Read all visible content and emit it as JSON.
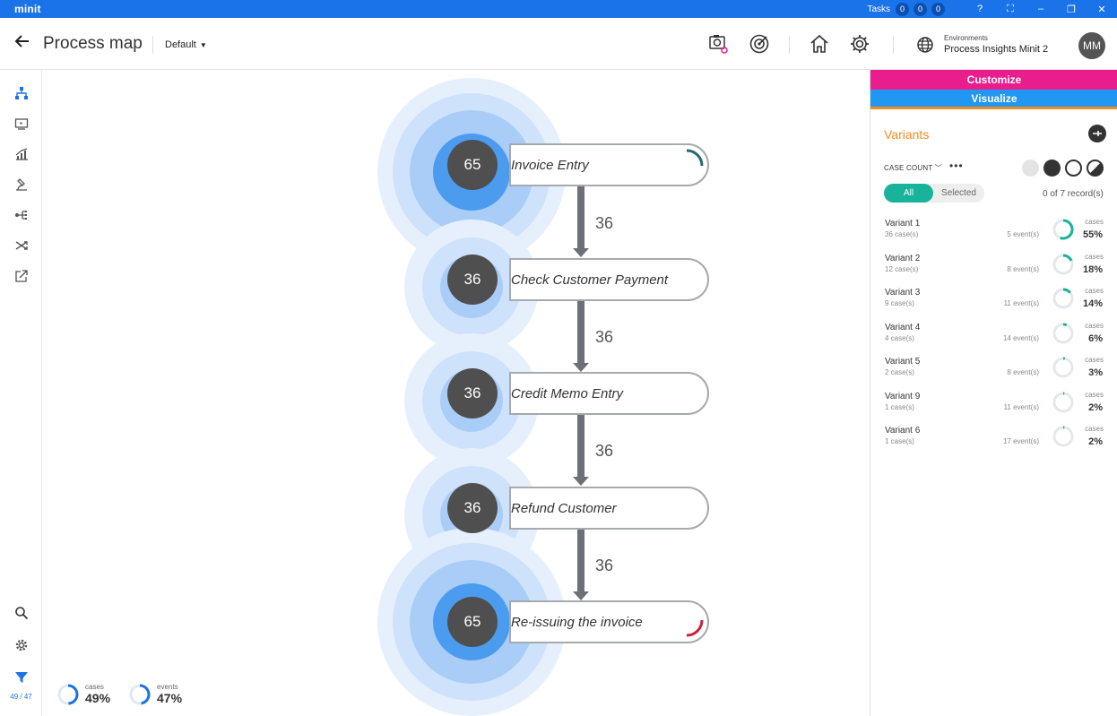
{
  "titlebar": {
    "brand": "minit",
    "tasks_label": "Tasks",
    "task_counts": [
      "0",
      "0",
      "0"
    ],
    "window_buttons": [
      "?",
      "⛶",
      "–",
      "❐",
      "✕"
    ],
    "color": "#1a73e8"
  },
  "header": {
    "title": "Process map",
    "view_select": "Default",
    "env_label": "Environments",
    "env_name": "Process Insights Minit 2",
    "avatar": "MM",
    "icons": [
      "screenshot-settings-icon",
      "target-icon",
      "home-icon",
      "gear-icon",
      "globe-icon"
    ]
  },
  "leftrail": {
    "icons": [
      "process-map-icon",
      "dashboard-icon",
      "chart-icon",
      "microscope-icon",
      "rules-icon",
      "shuffle-icon",
      "export-icon",
      "search-icon",
      "gear-icon",
      "filter-icon"
    ],
    "filter_count": "49 / 47",
    "active_color": "#1a73e8"
  },
  "process_map": {
    "nodes": [
      {
        "label": "Invoice Entry",
        "count": "65",
        "arc": "start"
      },
      {
        "label": "Check Customer Payment",
        "count": "36"
      },
      {
        "label": "Credit Memo Entry",
        "count": "36"
      },
      {
        "label": "Refund Customer",
        "count": "36"
      },
      {
        "label": "Re-issuing the invoice",
        "count": "65",
        "arc": "end"
      }
    ],
    "edges": [
      "36",
      "36",
      "36",
      "36"
    ],
    "stats": [
      {
        "label": "cases",
        "value": "49%",
        "fraction": 0.49
      },
      {
        "label": "events",
        "value": "47%",
        "fraction": 0.47
      }
    ]
  },
  "rightpanel": {
    "customize_label": "Customize",
    "visualize_label": "Visualize",
    "customize_color": "#e91e8c",
    "visualize_color": "#2196f3",
    "title": "Variants",
    "sort_label": "CASE COUNT",
    "toggle_all": "All",
    "toggle_selected": "Selected",
    "records": "0 of 7 record(s)",
    "variants": [
      {
        "name": "Variant 1",
        "cases": "36 case(s)",
        "events": "5 event(s)",
        "plabel": "cases",
        "pct": "55%",
        "fraction": 0.55
      },
      {
        "name": "Variant 2",
        "cases": "12 case(s)",
        "events": "8 event(s)",
        "plabel": "cases",
        "pct": "18%",
        "fraction": 0.18
      },
      {
        "name": "Variant 3",
        "cases": "9 case(s)",
        "events": "11 event(s)",
        "plabel": "cases",
        "pct": "14%",
        "fraction": 0.14
      },
      {
        "name": "Variant 4",
        "cases": "4 case(s)",
        "events": "14 event(s)",
        "plabel": "cases",
        "pct": "6%",
        "fraction": 0.06
      },
      {
        "name": "Variant 5",
        "cases": "2 case(s)",
        "events": "8 event(s)",
        "plabel": "cases",
        "pct": "3%",
        "fraction": 0.03
      },
      {
        "name": "Variant 9",
        "cases": "1 case(s)",
        "events": "11 event(s)",
        "plabel": "cases",
        "pct": "2%",
        "fraction": 0.02
      },
      {
        "name": "Variant 6",
        "cases": "1 case(s)",
        "events": "17 event(s)",
        "plabel": "cases",
        "pct": "2%",
        "fraction": 0.02
      }
    ]
  }
}
